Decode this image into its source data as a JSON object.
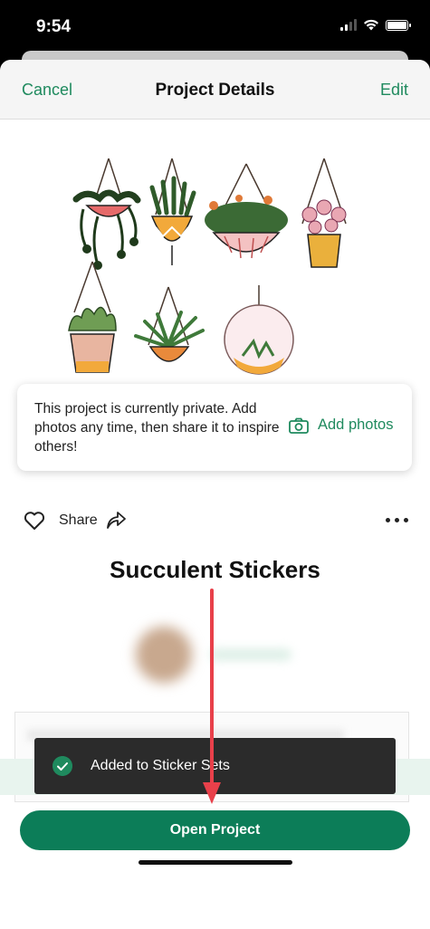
{
  "status_bar": {
    "time": "9:54"
  },
  "nav": {
    "cancel_label": "Cancel",
    "title": "Project Details",
    "edit_label": "Edit"
  },
  "private_notice": {
    "text": "This project is currently private. Add photos any time, then share it to inspire others!",
    "add_photos_label": "Add photos"
  },
  "actions": {
    "share_label": "Share"
  },
  "project": {
    "title": "Succulent Stickers"
  },
  "toast": {
    "message": "Added to Sticker Sets"
  },
  "footer": {
    "open_project_label": "Open Project"
  },
  "colors": {
    "accent": "#1f8a5e",
    "button": "#0c7d58",
    "toast_bg": "#2b2b2b",
    "arrow": "#e8404a"
  }
}
